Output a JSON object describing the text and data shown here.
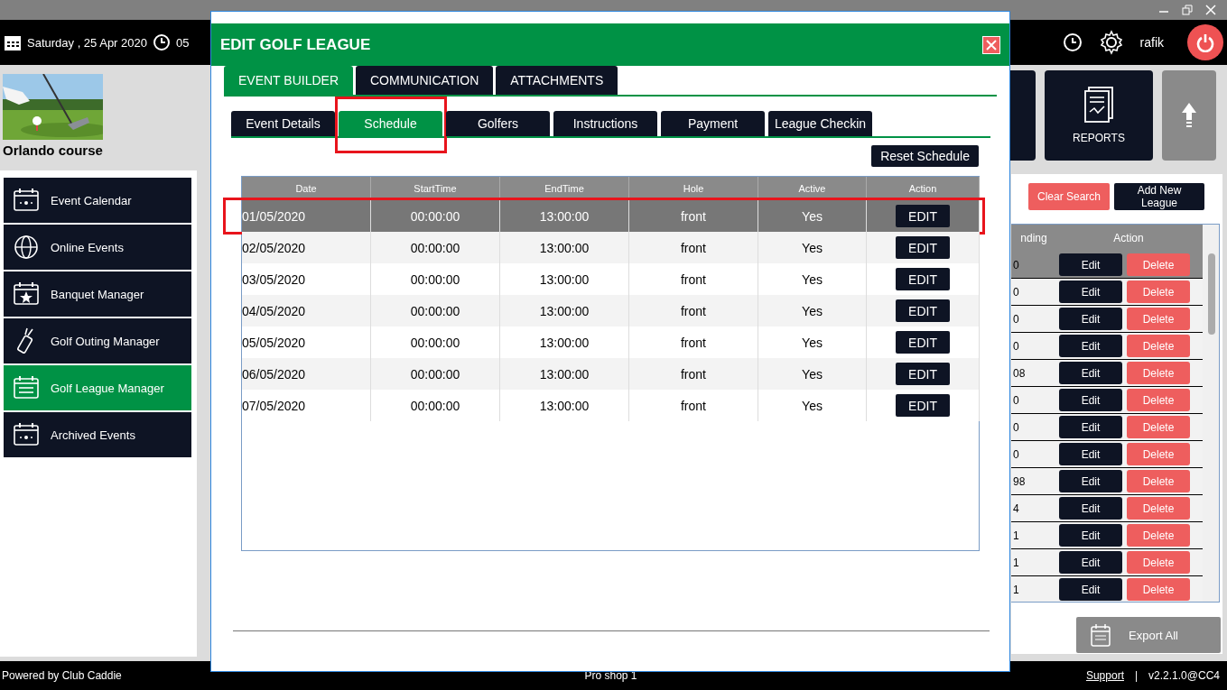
{
  "top_bar": {
    "date": "Saturday , 25 Apr 2020",
    "time": "05",
    "user": "rafik"
  },
  "course": {
    "name": "Orlando course"
  },
  "sidebar": {
    "items": [
      {
        "label": "Event Calendar",
        "selected": false
      },
      {
        "label": "Online Events",
        "selected": false
      },
      {
        "label": "Banquet Manager",
        "selected": false
      },
      {
        "label": "Golf Outing Manager",
        "selected": false
      },
      {
        "label": "Golf League Manager",
        "selected": true
      },
      {
        "label": "Archived Events",
        "selected": false
      }
    ]
  },
  "tiles": [
    {
      "kind": "blank"
    },
    {
      "kind": "reports",
      "label": "REPORTS"
    },
    {
      "kind": "up"
    }
  ],
  "league_panel": {
    "buttons": [
      {
        "kind": "clear",
        "label": "Clear Search"
      },
      {
        "kind": "add",
        "label": "Add New League"
      }
    ],
    "columns": [
      "nding",
      "Action"
    ],
    "rows": [
      {
        "column_1": "0",
        "selected": true,
        "actions": [
          "Edit",
          "Delete"
        ]
      },
      {
        "column_1": "0",
        "selected": false,
        "actions": [
          "Edit",
          "Delete"
        ]
      },
      {
        "column_1": "0",
        "selected": false,
        "actions": [
          "Edit",
          "Delete"
        ]
      },
      {
        "column_1": "0",
        "selected": false,
        "actions": [
          "Edit",
          "Delete"
        ]
      },
      {
        "column_1": "08",
        "selected": false,
        "actions": [
          "Edit",
          "Delete"
        ]
      },
      {
        "column_1": "0",
        "selected": false,
        "actions": [
          "Edit",
          "Delete"
        ]
      },
      {
        "column_1": "0",
        "selected": false,
        "actions": [
          "Edit",
          "Delete"
        ]
      },
      {
        "column_1": "0",
        "selected": false,
        "actions": [
          "Edit",
          "Delete"
        ]
      },
      {
        "column_1": "98",
        "selected": false,
        "actions": [
          "Edit",
          "Delete"
        ]
      },
      {
        "column_1": "4",
        "selected": false,
        "actions": [
          "Edit",
          "Delete"
        ]
      },
      {
        "column_1": "1",
        "selected": false,
        "actions": [
          "Edit",
          "Delete"
        ]
      },
      {
        "column_1": "1",
        "selected": false,
        "actions": [
          "Edit",
          "Delete"
        ]
      },
      {
        "column_1": "1",
        "selected": false,
        "actions": [
          "Edit",
          "Delete"
        ]
      }
    ],
    "export_button": "Export All"
  },
  "dialog": {
    "title": "EDIT GOLF LEAGUE",
    "tabs": [
      {
        "label": "EVENT BUILDER",
        "selected": true
      },
      {
        "label": "COMMUNICATION",
        "selected": false
      },
      {
        "label": "ATTACHMENTS",
        "selected": false
      }
    ],
    "subtabs": [
      {
        "label": "Event Details",
        "selected": false,
        "highlighted": false
      },
      {
        "label": "Schedule",
        "selected": true,
        "highlighted": true
      },
      {
        "label": "Golfers",
        "selected": false,
        "highlighted": false
      },
      {
        "label": "Instructions",
        "selected": false,
        "highlighted": false
      },
      {
        "label": "Payment",
        "selected": false,
        "highlighted": false
      },
      {
        "label": "League Checkin",
        "selected": false,
        "highlighted": false
      }
    ],
    "reset_button": "Reset Schedule",
    "table": {
      "columns": [
        "Date",
        "StartTime",
        "EndTime",
        "Hole",
        "Active",
        "Action"
      ],
      "rows": [
        {
          "date": "01/05/2020",
          "start": "00:00:00",
          "end": "13:00:00",
          "hole": "front",
          "active": "Yes",
          "action": "EDIT",
          "selected": true,
          "highlighted": true
        },
        {
          "date": "02/05/2020",
          "start": "00:00:00",
          "end": "13:00:00",
          "hole": "front",
          "active": "Yes",
          "action": "EDIT",
          "selected": false,
          "highlighted": false
        },
        {
          "date": "03/05/2020",
          "start": "00:00:00",
          "end": "13:00:00",
          "hole": "front",
          "active": "Yes",
          "action": "EDIT",
          "selected": false,
          "highlighted": false
        },
        {
          "date": "04/05/2020",
          "start": "00:00:00",
          "end": "13:00:00",
          "hole": "front",
          "active": "Yes",
          "action": "EDIT",
          "selected": false,
          "highlighted": false
        },
        {
          "date": "05/05/2020",
          "start": "00:00:00",
          "end": "13:00:00",
          "hole": "front",
          "active": "Yes",
          "action": "EDIT",
          "selected": false,
          "highlighted": false
        },
        {
          "date": "06/05/2020",
          "start": "00:00:00",
          "end": "13:00:00",
          "hole": "front",
          "active": "Yes",
          "action": "EDIT",
          "selected": false,
          "highlighted": false
        },
        {
          "date": "07/05/2020",
          "start": "00:00:00",
          "end": "13:00:00",
          "hole": "front",
          "active": "Yes",
          "action": "EDIT",
          "selected": false,
          "highlighted": false
        }
      ]
    }
  },
  "status_bar": {
    "left": "Powered by Club Caddie",
    "center": "Pro shop 1",
    "link": "Support",
    "separator": "|",
    "version": "v2.2.1.0@CC4"
  }
}
